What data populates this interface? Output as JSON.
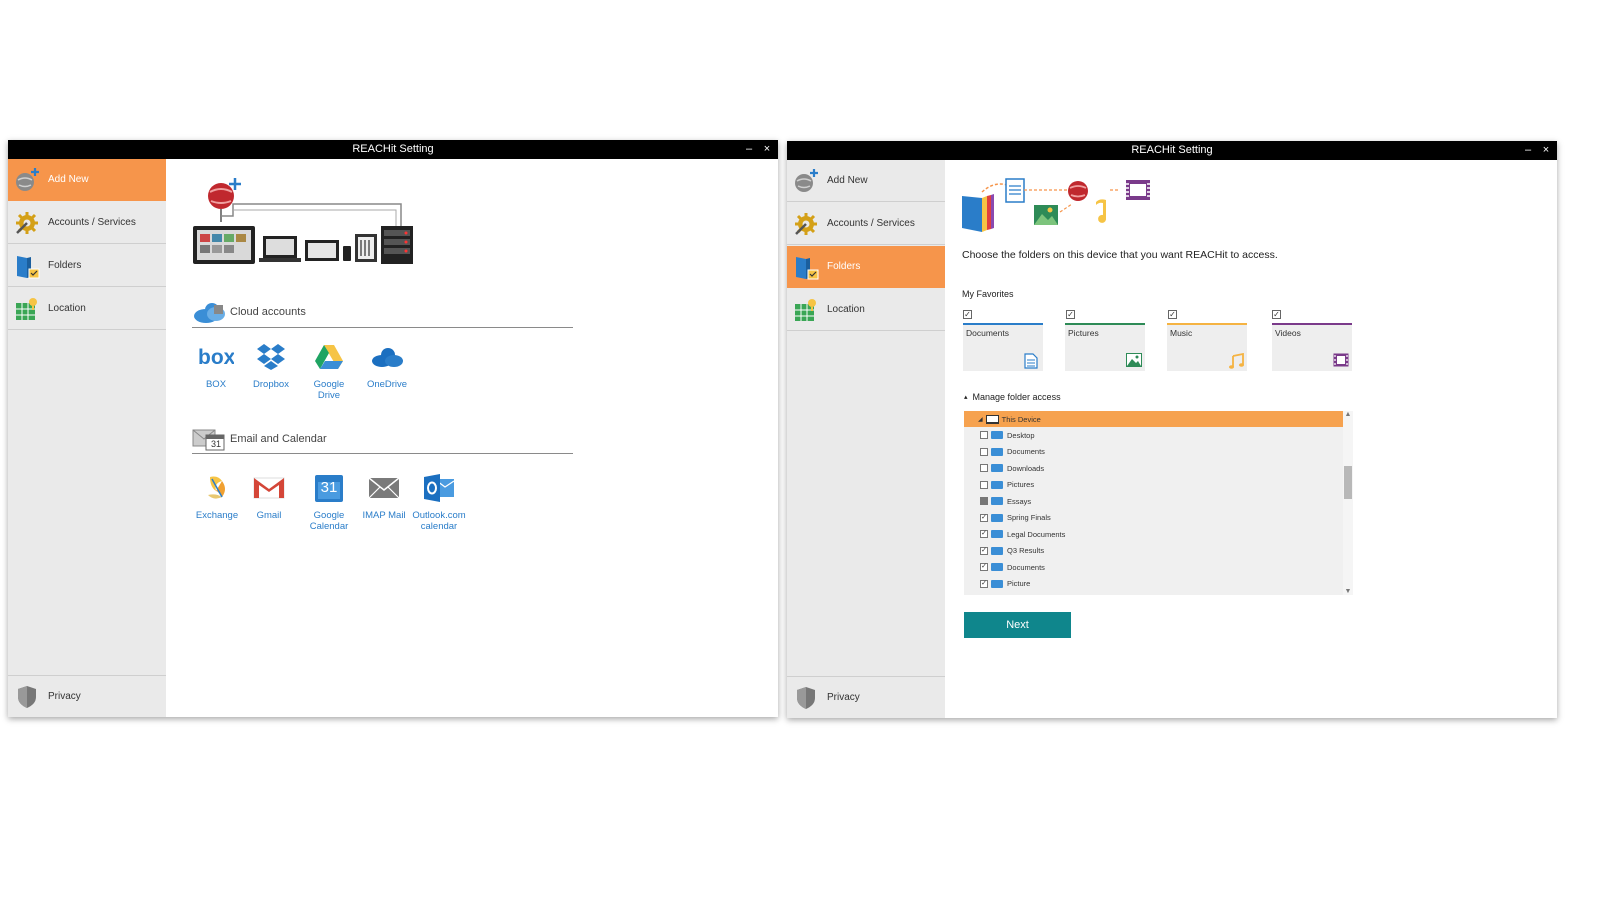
{
  "left_window": {
    "title": "REACHit Setting",
    "min_glyph": "–",
    "close_glyph": "×",
    "sidebar": {
      "items": [
        {
          "label": "Add New"
        },
        {
          "label": "Accounts / Services"
        },
        {
          "label": "Folders"
        },
        {
          "label": "Location"
        }
      ],
      "privacy": "Privacy"
    },
    "cloud": {
      "heading": "Cloud accounts",
      "services": [
        {
          "line1": "BOX",
          "line2": ""
        },
        {
          "line1": "Dropbox",
          "line2": ""
        },
        {
          "line1": "Google",
          "line2": "Drive"
        },
        {
          "line1": "OneDrive",
          "line2": ""
        }
      ]
    },
    "email": {
      "heading": "Email and Calendar",
      "calendar_day": "31",
      "services": [
        {
          "line1": "Exchange",
          "line2": ""
        },
        {
          "line1": "Gmail",
          "line2": ""
        },
        {
          "line1": "Google",
          "line2": "Calendar"
        },
        {
          "line1": "IMAP Mail",
          "line2": ""
        },
        {
          "line1": "Outlook.com",
          "line2": "calendar"
        }
      ]
    }
  },
  "right_window": {
    "title": "REACHit Setting",
    "min_glyph": "–",
    "close_glyph": "×",
    "sidebar": {
      "items": [
        {
          "label": "Add New"
        },
        {
          "label": "Accounts / Services"
        },
        {
          "label": "Folders"
        },
        {
          "label": "Location"
        }
      ],
      "privacy": "Privacy"
    },
    "instruction": "Choose the folders on this device that you want REACHit to access.",
    "favorites_heading": "My Favorites",
    "favorites": [
      {
        "label": "Documents",
        "checked": true,
        "color": "#2a7dc9"
      },
      {
        "label": "Pictures",
        "checked": true,
        "color": "#2e8b57"
      },
      {
        "label": "Music",
        "checked": true,
        "color": "#f5b342"
      },
      {
        "label": "Videos",
        "checked": true,
        "color": "#7a3a8a"
      }
    ],
    "manage_heading": "Manage folder access",
    "manage_arrow": "▴",
    "tree": [
      {
        "label": "This Device",
        "state": "",
        "selected": true
      },
      {
        "label": "Desktop",
        "state": "unchecked"
      },
      {
        "label": "Documents",
        "state": "unchecked"
      },
      {
        "label": "Downloads",
        "state": "unchecked"
      },
      {
        "label": "Pictures",
        "state": "unchecked"
      },
      {
        "label": "Essays",
        "state": "partial"
      },
      {
        "label": "Spring Finals",
        "state": "checked"
      },
      {
        "label": "Legal Documents",
        "state": "checked"
      },
      {
        "label": "Q3 Results",
        "state": "checked"
      },
      {
        "label": "Documents",
        "state": "checked"
      },
      {
        "label": "Picture",
        "state": "checked"
      }
    ],
    "next_label": "Next"
  },
  "colors": {
    "accent_orange": "#f6954b",
    "link_blue": "#2a7dc9",
    "next_teal": "#0f868c",
    "titlebar": "#000000"
  }
}
